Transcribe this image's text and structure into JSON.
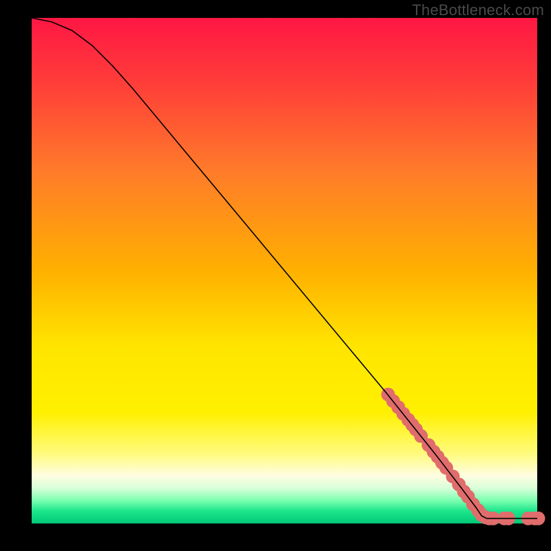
{
  "watermark": "TheBottleneck.com",
  "chart_data": {
    "type": "line",
    "title": "",
    "xlabel": "",
    "ylabel": "",
    "xlim": [
      0,
      100
    ],
    "ylim": [
      0,
      100
    ],
    "curve": [
      {
        "x": 0,
        "y": 100
      },
      {
        "x": 4,
        "y": 99.2
      },
      {
        "x": 8,
        "y": 97.5
      },
      {
        "x": 12,
        "y": 94.5
      },
      {
        "x": 16,
        "y": 90.5
      },
      {
        "x": 20,
        "y": 86
      },
      {
        "x": 25,
        "y": 80
      },
      {
        "x": 30,
        "y": 74
      },
      {
        "x": 40,
        "y": 62
      },
      {
        "x": 50,
        "y": 50
      },
      {
        "x": 60,
        "y": 38
      },
      {
        "x": 70,
        "y": 26
      },
      {
        "x": 80,
        "y": 13.5
      },
      {
        "x": 85,
        "y": 7
      },
      {
        "x": 88,
        "y": 3
      },
      {
        "x": 89,
        "y": 1.5
      },
      {
        "x": 90,
        "y": 1
      },
      {
        "x": 95,
        "y": 1
      },
      {
        "x": 100,
        "y": 1
      }
    ],
    "marker_points": [
      {
        "x": 70.5,
        "y": 25.5
      },
      {
        "x": 71.5,
        "y": 24.2
      },
      {
        "x": 72.5,
        "y": 23.0
      },
      {
        "x": 73.5,
        "y": 21.7
      },
      {
        "x": 74.5,
        "y": 20.5
      },
      {
        "x": 75.3,
        "y": 19.5
      },
      {
        "x": 76.0,
        "y": 18.6
      },
      {
        "x": 77.0,
        "y": 17.3
      },
      {
        "x": 78.5,
        "y": 15.5
      },
      {
        "x": 79.5,
        "y": 14.2
      },
      {
        "x": 80.3,
        "y": 13.2
      },
      {
        "x": 81.2,
        "y": 12.0
      },
      {
        "x": 82.0,
        "y": 11.0
      },
      {
        "x": 83.3,
        "y": 9.3
      },
      {
        "x": 84.5,
        "y": 7.7
      },
      {
        "x": 85.5,
        "y": 6.3
      },
      {
        "x": 86.3,
        "y": 5.3
      },
      {
        "x": 87.3,
        "y": 3.8
      },
      {
        "x": 88.3,
        "y": 2.6
      },
      {
        "x": 89.0,
        "y": 1.7
      },
      {
        "x": 89.8,
        "y": 1.2
      },
      {
        "x": 90.5,
        "y": 1.0
      },
      {
        "x": 91.3,
        "y": 1.0
      },
      {
        "x": 93.5,
        "y": 1.0
      },
      {
        "x": 94.3,
        "y": 1.0
      },
      {
        "x": 98.2,
        "y": 1.0
      },
      {
        "x": 99.5,
        "y": 1.0
      },
      {
        "x": 100.2,
        "y": 1.0
      }
    ],
    "marker_color": "#e06c6c",
    "marker_radius_px": 10,
    "curve_color": "#000000",
    "gradient_stops": [
      {
        "offset": 0,
        "color": "#ff1744"
      },
      {
        "offset": 0.12,
        "color": "#ff3a3a"
      },
      {
        "offset": 0.3,
        "color": "#ff7a2a"
      },
      {
        "offset": 0.5,
        "color": "#ffb000"
      },
      {
        "offset": 0.65,
        "color": "#ffe500"
      },
      {
        "offset": 0.78,
        "color": "#fff000"
      },
      {
        "offset": 0.86,
        "color": "#fffb7a"
      },
      {
        "offset": 0.905,
        "color": "#fffde0"
      },
      {
        "offset": 0.93,
        "color": "#d9ffd9"
      },
      {
        "offset": 0.955,
        "color": "#7affb0"
      },
      {
        "offset": 0.975,
        "color": "#1ee68c"
      },
      {
        "offset": 1.0,
        "color": "#00c878"
      }
    ]
  }
}
